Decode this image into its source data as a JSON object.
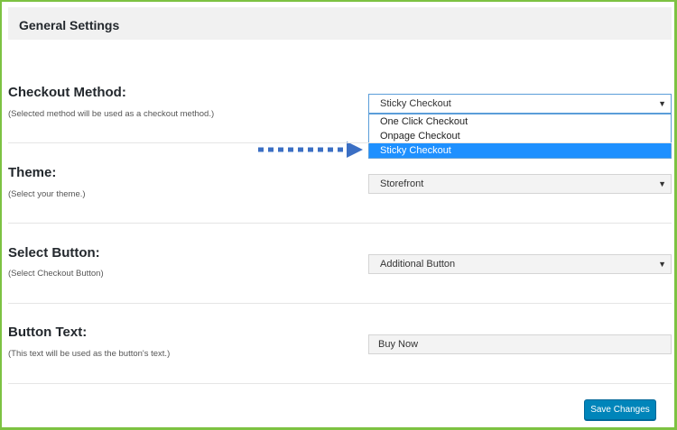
{
  "header": {
    "title": "General Settings"
  },
  "checkout_method": {
    "label": "Checkout Method:",
    "description": "(Selected method will be used as a checkout method.)",
    "selected": "Sticky Checkout",
    "options": [
      "One Click Checkout",
      "Onpage Checkout",
      "Sticky Checkout"
    ]
  },
  "theme": {
    "label": "Theme:",
    "description": "(Select your theme.)",
    "selected": "Storefront"
  },
  "select_button": {
    "label": "Select Button:",
    "description": "(Select Checkout Button)",
    "selected": "Additional Button"
  },
  "button_text": {
    "label": "Button Text:",
    "description": "(This text will be used as the button's text.)",
    "value": "Buy Now"
  },
  "actions": {
    "save_label": "Save Changes"
  },
  "icons": {
    "dropdown_arrow": "▼"
  },
  "colors": {
    "accent": "#0085ba",
    "highlight": "#1e90ff",
    "frame_border": "#7dc242",
    "pointer_arrow": "#3b6fc4"
  }
}
